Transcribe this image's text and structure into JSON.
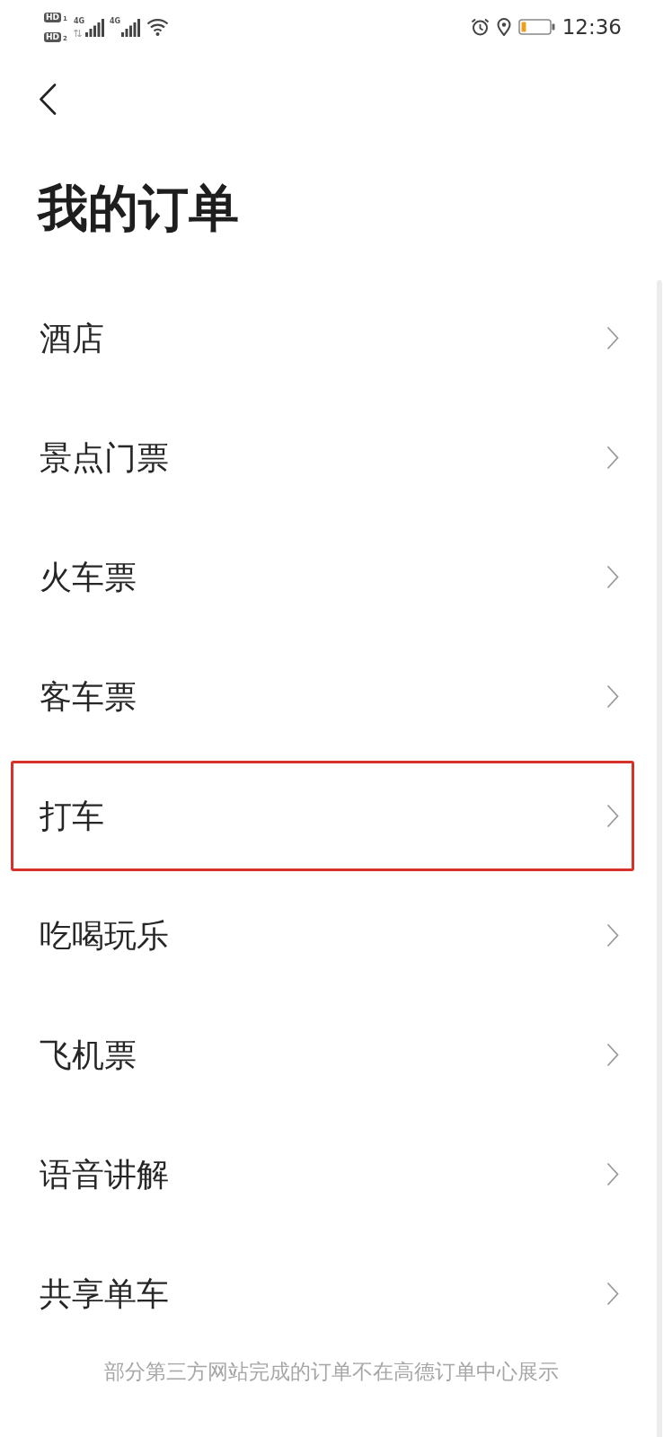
{
  "status_bar": {
    "sims": [
      {
        "badge": "HD",
        "slot": "1"
      },
      {
        "badge": "HD",
        "slot": "2"
      }
    ],
    "networks": [
      {
        "label": "4G",
        "data_arrows": true
      },
      {
        "label": "4G",
        "data_arrows": false
      }
    ],
    "time": "12:36"
  },
  "header": {
    "title": "我的订单"
  },
  "items": [
    {
      "label": "酒店",
      "highlighted": false
    },
    {
      "label": "景点门票",
      "highlighted": false
    },
    {
      "label": "火车票",
      "highlighted": false
    },
    {
      "label": "客车票",
      "highlighted": false
    },
    {
      "label": "打车",
      "highlighted": true
    },
    {
      "label": "吃喝玩乐",
      "highlighted": false
    },
    {
      "label": "飞机票",
      "highlighted": false
    },
    {
      "label": "语音讲解",
      "highlighted": false
    },
    {
      "label": "共享单车",
      "highlighted": false
    }
  ],
  "footer": "部分第三方网站完成的订单不在高德订单中心展示"
}
